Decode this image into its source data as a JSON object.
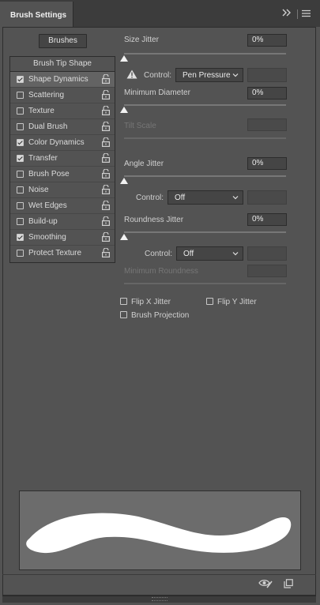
{
  "panel": {
    "title": "Brush Settings",
    "expand_icon": "double-chevron-right-icon",
    "menu_icon": "hamburger-menu-icon"
  },
  "brushes_button": "Brushes",
  "list": {
    "title": "Brush Tip Shape",
    "items": [
      {
        "label": "Shape Dynamics",
        "checked": true,
        "selected": true
      },
      {
        "label": "Scattering",
        "checked": false
      },
      {
        "label": "Texture",
        "checked": false
      },
      {
        "label": "Dual Brush",
        "checked": false
      },
      {
        "label": "Color Dynamics",
        "checked": true
      },
      {
        "label": "Transfer",
        "checked": true
      },
      {
        "label": "Brush Pose",
        "checked": false
      },
      {
        "label": "Noise",
        "checked": false
      },
      {
        "label": "Wet Edges",
        "checked": false
      },
      {
        "label": "Build-up",
        "checked": false
      },
      {
        "label": "Smoothing",
        "checked": true
      },
      {
        "label": "Protect Texture",
        "checked": false
      }
    ]
  },
  "size_jitter": {
    "label": "Size Jitter",
    "value": "0%",
    "control_label": "Control:",
    "control_value": "Pen Pressure",
    "warning_icon": "warning-triangle-icon"
  },
  "minimum_diameter": {
    "label": "Minimum Diameter",
    "value": "0%"
  },
  "tilt_scale": {
    "label": "Tilt Scale",
    "value": ""
  },
  "angle_jitter": {
    "label": "Angle Jitter",
    "value": "0%",
    "control_label": "Control:",
    "control_value": "Off"
  },
  "roundness_jitter": {
    "label": "Roundness Jitter",
    "value": "0%",
    "control_label": "Control:",
    "control_value": "Off"
  },
  "minimum_roundness": {
    "label": "Minimum Roundness",
    "value": ""
  },
  "flip_x": {
    "label": "Flip X Jitter",
    "checked": false
  },
  "flip_y": {
    "label": "Flip Y Jitter",
    "checked": false
  },
  "brush_projection": {
    "label": "Brush Projection",
    "checked": false
  },
  "footer": {
    "toggle_preview_icon": "eye-brush-icon",
    "new_preset_icon": "new-preset-icon"
  },
  "colors": {
    "panel_bg": "#535353",
    "header_bg": "#3c3c3c",
    "field_bg": "#454545",
    "preview_bg": "#6c6c6c"
  }
}
